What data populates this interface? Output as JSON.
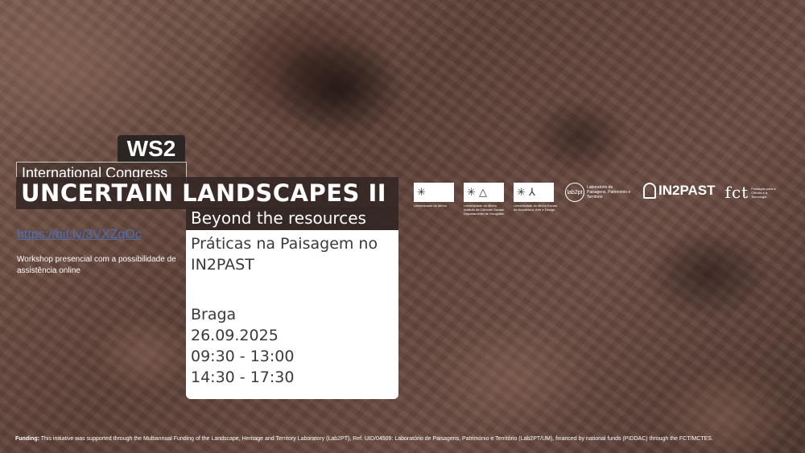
{
  "event": {
    "tag": "WS2",
    "congress": "International Congress",
    "title": "UNCERTAIN LANDSCAPES II",
    "subtitle": "Beyond the resources"
  },
  "card": {
    "lines": [
      "Práticas na Paisagem no",
      "IN2PAST"
    ],
    "location": "Braga",
    "date": "26.09.2025",
    "times": [
      "09:30 - 13:00",
      "14:30 - 17:30"
    ]
  },
  "registration": {
    "link": "https://bit.ly/3VXZgOc",
    "note": "Workshop presencial  com a possibilidade de assistência online"
  },
  "logos": {
    "uminho_1": {
      "caption": "Universidade do Minho"
    },
    "uminho_2": {
      "caption": "Universidade do Minho Instituto de Ciências Sociais Departamento de Geografia"
    },
    "uminho_3": {
      "caption": "Universidade do Minho Escola de Arquitetura, Arte e Design"
    },
    "lab2pt": {
      "mark": "lab2pt",
      "text": "Laboratório de Paisagens, Património e Território"
    },
    "in2past": {
      "name": "IN2PAST"
    },
    "fct": {
      "name": "fct",
      "text": "Fundação para a Ciência e a Tecnologia"
    }
  },
  "funding": {
    "label": "Funding:",
    "text": "This initiative was supported through the Multiannual Funding of the Landscape, Heritage and Territory Laboratory (Lab2PT),  Ref. UID/04509: Laboratório de Paisagens, Património e Território (Lab2PT/UM), financed by national funds (PIDDAC) through the FCT/MCTES."
  }
}
